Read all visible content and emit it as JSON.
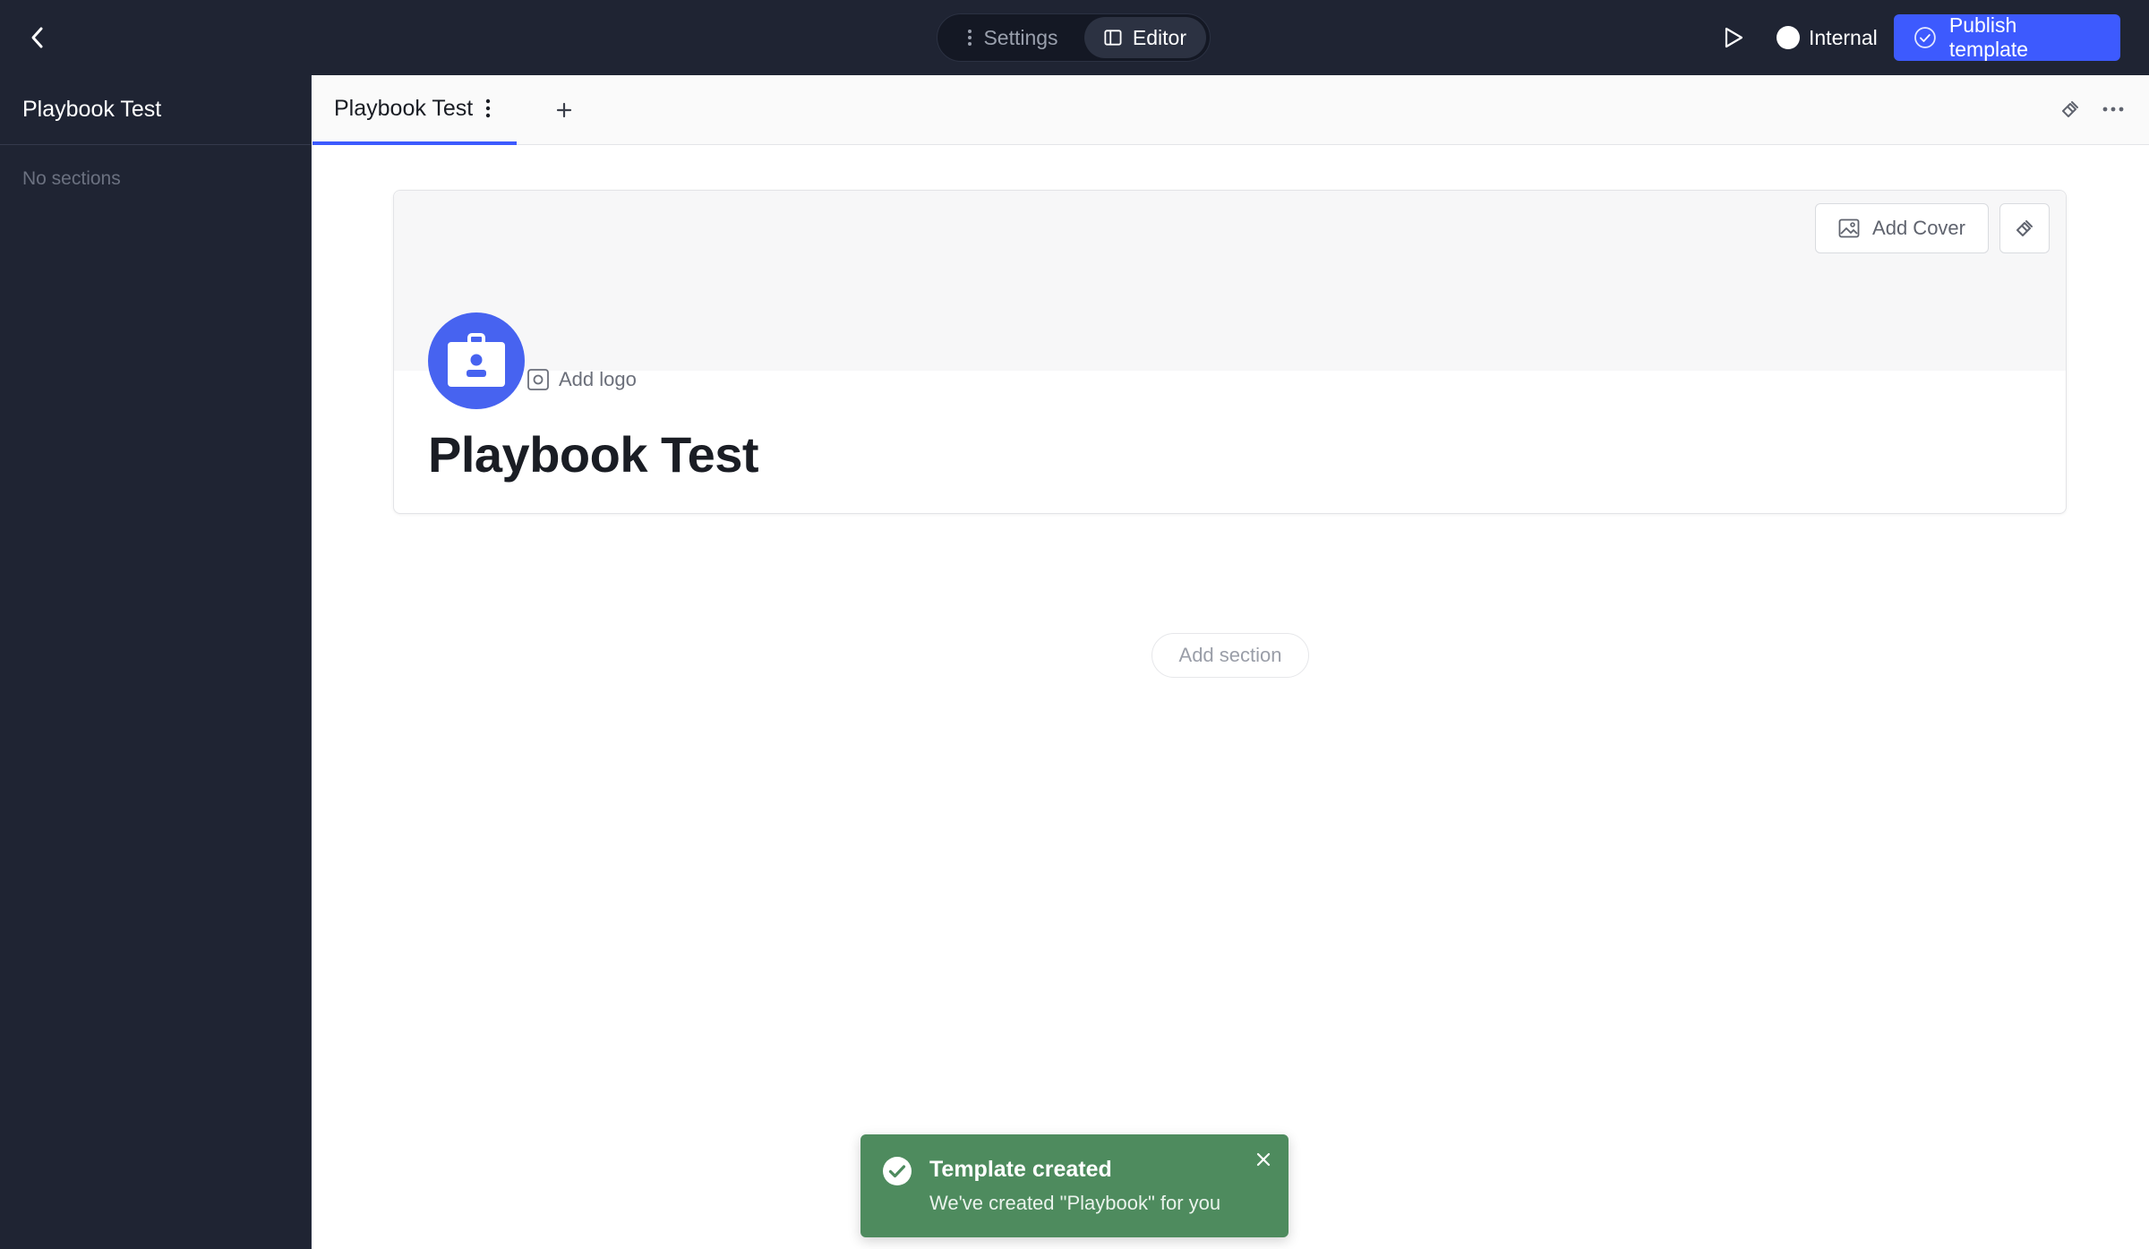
{
  "topbar": {
    "back_icon": "chevron-left-icon",
    "settings_label": "Settings",
    "editor_label": "Editor",
    "play_icon": "play-icon",
    "visibility_label": "Internal",
    "publish_label": "Publish template"
  },
  "sidebar": {
    "title": "Playbook Test",
    "empty_label": "No sections"
  },
  "tabs": {
    "items": [
      {
        "label": "Playbook Test"
      }
    ],
    "add_label": "+"
  },
  "card": {
    "add_cover_label": "Add Cover",
    "add_logo_label": "Add logo",
    "title": "Playbook Test"
  },
  "main": {
    "add_section_label": "Add section"
  },
  "toast": {
    "title": "Template created",
    "message": "We've created \"Playbook\" for you"
  },
  "colors": {
    "dark_bg": "#1f2433",
    "accent": "#3d5afe",
    "logo": "#4763f0",
    "toast": "#4e8b5e"
  }
}
